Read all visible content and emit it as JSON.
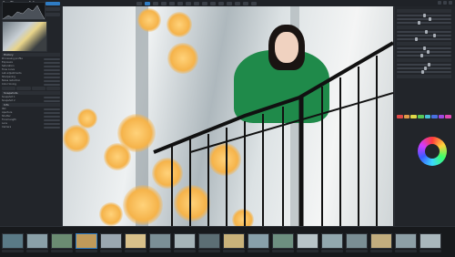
{
  "app": {
    "title": "RawTherapee 5.8"
  },
  "toolbar": {
    "icons": [
      "history-icon",
      "edit-icon",
      "crop-icon",
      "rotate-icon",
      "straighten-icon",
      "wb-picker-icon",
      "compare-icon",
      "zoom-fit-icon",
      "zoom-100-icon",
      "zoom-in-icon",
      "zoom-out-icon",
      "before-after-icon",
      "queue-icon",
      "export-icon",
      "preferences-icon"
    ],
    "active_index": 1
  },
  "left_panel": {
    "histogram_tabs": [
      "RGB",
      "Luma",
      "Raw"
    ],
    "sections": [
      {
        "title": "History",
        "rows": [
          "Processing profile",
          "Exposure",
          "Saturation",
          "Tone curve",
          "Lab adjustments",
          "Sharpening",
          "Noise reduction",
          "Color toning"
        ]
      },
      {
        "title": "Snapshots",
        "rows": [
          "Snapshot 1",
          "Snapshot 2"
        ]
      },
      {
        "title": "Info",
        "rows": [
          "ISO",
          "Aperture",
          "Shutter",
          "Focal length",
          "Lens",
          "Camera"
        ]
      }
    ]
  },
  "right_panel": {
    "sections": [
      "Exposure",
      "Tone curve",
      "Color",
      "Lab adjustments",
      "Color wheel"
    ],
    "sliders": [
      0.5,
      0.62,
      0.4,
      0.55,
      0.7,
      0.35,
      0.5,
      0.58,
      0.45,
      0.6,
      0.52,
      0.48,
      0.66,
      0.41
    ]
  },
  "colors": {
    "accent": "#2f7cc4",
    "bokeh": "#f5b34a",
    "jacket": "#1f8a4a"
  },
  "filmstrip": {
    "count": 18,
    "selected_index": 3,
    "thumb_colors": [
      "#5a7a86",
      "#8aa0a8",
      "#6b8c72",
      "#c09a5a",
      "#9aa7b0",
      "#d8c08a",
      "#7b8f96",
      "#a6b4b8",
      "#5c6e74",
      "#c9b27a",
      "#88a0aa",
      "#6d8f80",
      "#b8c4c8",
      "#92a8ae",
      "#7a8e94",
      "#c2ad7e",
      "#8d9fa6",
      "#a9b7bc"
    ]
  }
}
